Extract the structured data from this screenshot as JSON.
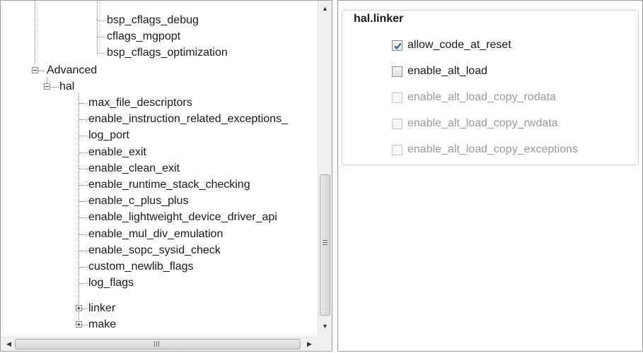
{
  "tree": {
    "top_items": [
      "bsp_cflags_debug",
      "cflags_mgpopt",
      "bsp_cflags_optimization"
    ],
    "advanced_label": "Advanced",
    "hal_label": "hal",
    "hal_items": [
      "max_file_descriptors",
      "enable_instruction_related_exceptions_",
      "log_port",
      "enable_exit",
      "enable_clean_exit",
      "enable_runtime_stack_checking",
      "enable_c_plus_plus",
      "enable_lightweight_device_driver_api",
      "enable_mul_div_emulation",
      "enable_sopc_sysid_check",
      "custom_newlib_flags",
      "log_flags"
    ],
    "linker_label": "linker",
    "make_label": "make"
  },
  "scrollbars": {
    "up_arrow": "▲",
    "down_arrow": "▼",
    "left_arrow": "◀",
    "right_arrow": "▶"
  },
  "panel": {
    "group_title": "hal.linker",
    "options": [
      {
        "label": "allow_code_at_reset",
        "checked": true,
        "enabled": true
      },
      {
        "label": "enable_alt_load",
        "checked": false,
        "enabled": true
      },
      {
        "label": "enable_alt_load_copy_rodata",
        "checked": false,
        "enabled": false
      },
      {
        "label": "enable_alt_load_copy_rwdata",
        "checked": false,
        "enabled": false
      },
      {
        "label": "enable_alt_load_copy_exceptions",
        "checked": false,
        "enabled": false
      }
    ]
  }
}
